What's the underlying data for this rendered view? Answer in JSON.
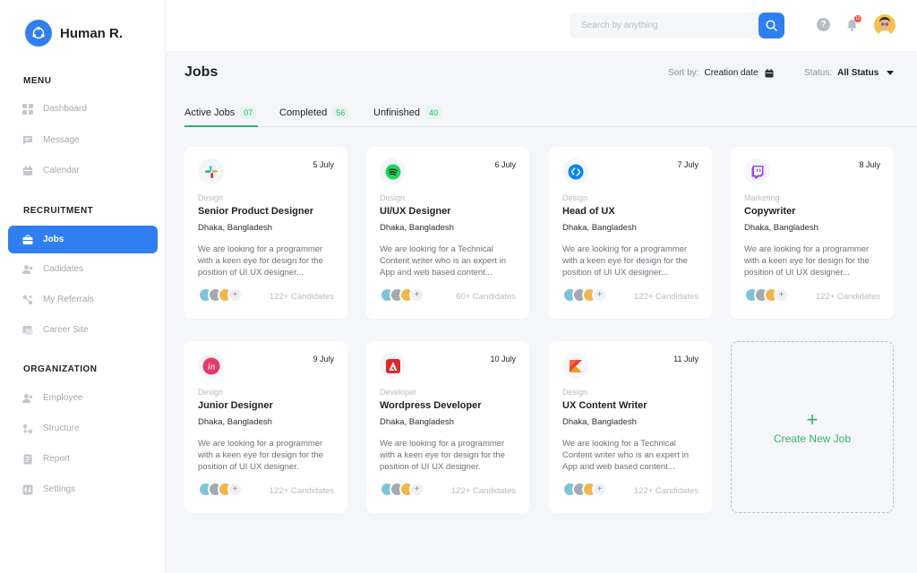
{
  "brand": {
    "name": "Human R.",
    "logo_icon": "share-nodes-icon",
    "accent": "#2f7ff0"
  },
  "sidebar": {
    "sections": [
      {
        "label": "MENU",
        "items": [
          {
            "label": "Dashboard",
            "icon": "grid-icon"
          },
          {
            "label": "Message",
            "icon": "message-icon"
          },
          {
            "label": "Calendar",
            "icon": "calendar-icon"
          }
        ]
      },
      {
        "label": "RECRUITMENT",
        "items": [
          {
            "label": "Jobs",
            "icon": "briefcase-icon",
            "active": true
          },
          {
            "label": "Cadidates",
            "icon": "users-icon"
          },
          {
            "label": "My Referrals",
            "icon": "referral-icon"
          },
          {
            "label": "Career Site",
            "icon": "browser-icon"
          }
        ]
      },
      {
        "label": "ORGANIZATION",
        "items": [
          {
            "label": "Employee",
            "icon": "users-icon"
          },
          {
            "label": "Structure",
            "icon": "structure-icon"
          },
          {
            "label": "Report",
            "icon": "report-icon"
          },
          {
            "label": "Settings",
            "icon": "settings-icon"
          }
        ]
      }
    ]
  },
  "topbar": {
    "search_placeholder": "Search by anything",
    "help_icon": "question-icon",
    "bell_icon": "bell-icon",
    "bell_badge": "10",
    "avatar": "user-avatar"
  },
  "page": {
    "title": "Jobs",
    "sort_label": "Sort by:",
    "sort_value": "Creation date",
    "status_label": "Status:",
    "status_value": "All Status"
  },
  "tabs": [
    {
      "label": "Active Jobs",
      "count": "07",
      "active": true
    },
    {
      "label": "Completed",
      "count": "56"
    },
    {
      "label": "Unfinished",
      "count": "40"
    }
  ],
  "jobs": [
    {
      "date": "5 July",
      "category": "Design",
      "title": "Senior Product Designer",
      "location": "Dhaka, Bangladesh",
      "description": "We are looking for a programmer with a keen eye for design for the position of UI UX designer...",
      "candidates": "122+ Candidates",
      "logo": "slack-icon"
    },
    {
      "date": "6 July",
      "category": "Design",
      "title": "UI/UX Designer",
      "location": "Dhaka, Bangladesh",
      "description": "We are looking for a Technical Content writer who is an expert in App and web based content...",
      "candidates": "60+ Candidates",
      "logo": "spotify-icon"
    },
    {
      "date": "7 July",
      "category": "Design",
      "title": "Head of UX",
      "location": "Dhaka, Bangladesh",
      "description": "We are looking for a programmer with a keen eye for design for the position of UI UX designer...",
      "candidates": "122+ Candidates",
      "logo": "shazam-icon"
    },
    {
      "date": "8 July",
      "category": "Marketing",
      "title": "Copywriter",
      "location": "Dhaka, Bangladesh",
      "description": "We are looking for a programmer with a keen eye for design for the position of UI UX designer...",
      "candidates": "122+ Candidates",
      "logo": "twitch-icon"
    },
    {
      "date": "9 July",
      "category": "Design",
      "title": "Junior Designer",
      "location": "Dhaka, Bangladesh",
      "description": "We are looking for a programmer with a keen eye for design for the position of UI UX designer.",
      "candidates": "122+ Candidates",
      "logo": "invision-icon"
    },
    {
      "date": "10 July",
      "category": "Developer",
      "title": "Wordpress Developer",
      "location": "Dhaka, Bangladesh",
      "description": "We are looking for a programmer with a keen eye for design for the position of UI UX designer.",
      "candidates": "122+ Candidates",
      "logo": "adobe-icon"
    },
    {
      "date": "11 July",
      "category": "Design",
      "title": "UX Content Writer",
      "location": "Dhaka, Bangladesh",
      "description": "We are looking for a Technical Content writer who is an expert in App and web based content...",
      "candidates": "122+ Candidates",
      "logo": "kotlin-icon"
    }
  ],
  "create_job": {
    "plus": "+",
    "label": "Create New Job"
  },
  "colors": {
    "accent": "#2f7ff0",
    "success": "#34b36f",
    "badge": "#ef4b42"
  }
}
